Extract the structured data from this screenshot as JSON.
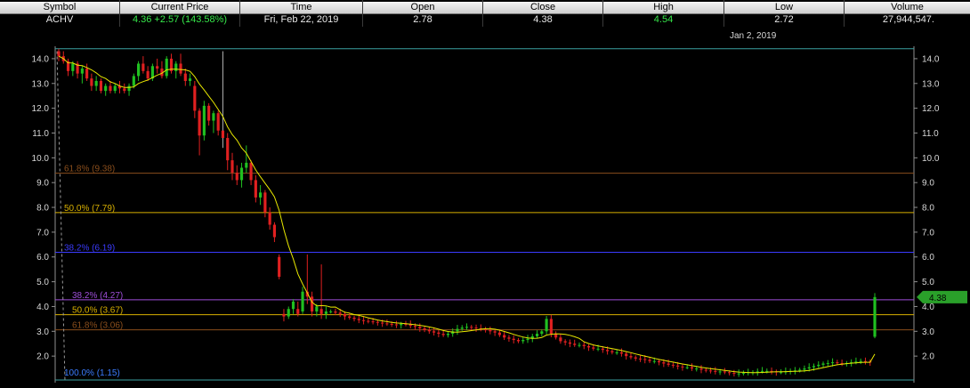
{
  "quote": {
    "headers": {
      "symbol": "Symbol",
      "current_price": "Current Price",
      "time": "Time",
      "open": "Open",
      "close": "Close",
      "high": "High",
      "low": "Low",
      "volume": "Volume"
    },
    "values": {
      "symbol": "ACHV",
      "current_price": "4.36",
      "change": "+2.57 (143.58%)",
      "time": "Fri, Feb 22, 2019",
      "open": "2.78",
      "close": "4.38",
      "high": "4.54",
      "low": "2.72",
      "volume": "27,944,547."
    }
  },
  "colors": {
    "up_candle": "#20c020",
    "down_candle": "#e02020",
    "moving_average": "#e8e800",
    "high_value": "#36e84a",
    "last_price_tag": "#2aa02a"
  },
  "chart_data": {
    "type": "candlestick",
    "cursor_date_label": "Jan 2, 2019",
    "ylim": [
      1.0,
      14.5
    ],
    "yticks": [
      "14.0",
      "13.0",
      "12.0",
      "11.0",
      "10.0",
      "9.0",
      "8.0",
      "7.0",
      "6.0",
      "5.0",
      "4.0",
      "3.0",
      "2.0"
    ],
    "last_price_label": "4.38",
    "fib_levels_major": [
      {
        "label": "61.8% (9.38)",
        "value": 9.38,
        "color": "#8a4e1c"
      },
      {
        "label": "50.0% (7.79)",
        "value": 7.79,
        "color": "#d8b000"
      },
      {
        "label": "38.2% (6.19)",
        "value": 6.19,
        "color": "#3b3bff"
      },
      {
        "label": "100.0% (1.15)",
        "value": 1.15,
        "color": "#3b7cff"
      }
    ],
    "fib_levels_minor": [
      {
        "label": "38.2% (4.27)",
        "value": 4.27,
        "color": "#9e4ed8"
      },
      {
        "label": "50.0% (3.67)",
        "value": 3.67,
        "color": "#d8b000"
      },
      {
        "label": "61.8% (3.06)",
        "value": 3.06,
        "color": "#8a4e1c"
      }
    ],
    "top_line": 14.4,
    "candles": [
      [
        14.3,
        14.4,
        13.9,
        14.1
      ],
      [
        14.1,
        14.3,
        13.8,
        13.9
      ],
      [
        13.9,
        14.0,
        13.3,
        13.5
      ],
      [
        13.5,
        13.9,
        13.3,
        13.8
      ],
      [
        13.8,
        13.9,
        13.2,
        13.4
      ],
      [
        13.4,
        13.7,
        13.0,
        13.6
      ],
      [
        13.6,
        13.8,
        13.1,
        13.2
      ],
      [
        13.2,
        13.4,
        12.7,
        12.9
      ],
      [
        12.9,
        13.3,
        12.7,
        13.1
      ],
      [
        13.1,
        13.2,
        12.6,
        12.7
      ],
      [
        12.7,
        13.0,
        12.5,
        12.9
      ],
      [
        12.9,
        13.1,
        12.6,
        12.7
      ],
      [
        12.7,
        13.0,
        12.6,
        12.9
      ],
      [
        12.9,
        13.1,
        12.6,
        12.8
      ],
      [
        12.8,
        13.0,
        12.6,
        12.7
      ],
      [
        12.7,
        13.0,
        12.5,
        12.9
      ],
      [
        12.9,
        13.4,
        12.8,
        13.3
      ],
      [
        13.3,
        13.9,
        13.1,
        13.8
      ],
      [
        13.8,
        14.1,
        13.4,
        13.5
      ],
      [
        13.5,
        13.7,
        13.1,
        13.2
      ],
      [
        13.2,
        13.8,
        13.1,
        13.7
      ],
      [
        13.7,
        14.0,
        13.4,
        13.6
      ],
      [
        13.6,
        13.9,
        13.2,
        13.3
      ],
      [
        13.3,
        14.1,
        13.2,
        14.0
      ],
      [
        14.0,
        14.2,
        13.4,
        13.5
      ],
      [
        13.5,
        13.9,
        13.2,
        13.8
      ],
      [
        13.8,
        14.2,
        13.3,
        13.4
      ],
      [
        13.4,
        13.6,
        12.9,
        13.1
      ],
      [
        13.1,
        13.4,
        12.9,
        13.2
      ],
      [
        12.9,
        13.1,
        11.6,
        11.9
      ],
      [
        11.9,
        12.0,
        10.1,
        10.9
      ],
      [
        10.9,
        12.3,
        10.7,
        12.1
      ],
      [
        12.1,
        12.2,
        11.3,
        11.5
      ],
      [
        11.5,
        11.9,
        11.0,
        11.8
      ],
      [
        11.8,
        11.9,
        10.9,
        11.1
      ],
      [
        11.1,
        14.3,
        10.4,
        10.8
      ],
      [
        10.8,
        11.0,
        9.5,
        9.9
      ],
      [
        9.9,
        10.2,
        9.1,
        9.4
      ],
      [
        9.4,
        9.7,
        8.9,
        9.1
      ],
      [
        9.1,
        9.8,
        8.8,
        9.6
      ],
      [
        9.6,
        10.5,
        9.4,
        9.8
      ],
      [
        9.8,
        9.9,
        8.9,
        9.1
      ],
      [
        9.1,
        9.3,
        8.2,
        8.4
      ],
      [
        8.4,
        8.9,
        8.1,
        8.6
      ],
      [
        8.6,
        8.7,
        7.6,
        7.8
      ],
      [
        7.8,
        8.0,
        7.1,
        7.3
      ],
      [
        7.3,
        7.4,
        6.6,
        6.8
      ],
      [
        6.0,
        6.1,
        5.1,
        5.2
      ],
      [
        3.7,
        3.9,
        3.4,
        3.6
      ],
      [
        3.6,
        4.0,
        3.5,
        3.9
      ],
      [
        3.9,
        4.3,
        3.7,
        4.2
      ],
      [
        3.9,
        4.2,
        3.6,
        3.7
      ],
      [
        3.8,
        4.8,
        3.7,
        4.6
      ],
      [
        4.6,
        6.1,
        4.1,
        4.4
      ],
      [
        4.4,
        4.6,
        3.6,
        3.8
      ],
      [
        3.8,
        4.1,
        3.6,
        4.0
      ],
      [
        3.9,
        5.7,
        3.5,
        3.7
      ],
      [
        3.7,
        4.0,
        3.5,
        3.8
      ]
    ],
    "late_closes": [
      3.8,
      3.75,
      3.7,
      3.6,
      3.55,
      3.5,
      3.45,
      3.42,
      3.4,
      3.38,
      3.35,
      3.32,
      3.3,
      3.28,
      3.25,
      3.3,
      3.28,
      3.22,
      3.18,
      3.12,
      3.05,
      3.0,
      2.95,
      2.9,
      2.85,
      2.9,
      3.0,
      3.1,
      3.15,
      3.18,
      3.15,
      3.12,
      3.08,
      3.05,
      3.0,
      2.95,
      2.85,
      2.75,
      2.7,
      2.65,
      2.6,
      2.65,
      2.7,
      2.8,
      2.9,
      3.0,
      3.5,
      2.9,
      2.75,
      2.6,
      2.55,
      2.5,
      2.45,
      2.45,
      2.4,
      2.35,
      2.3,
      2.3,
      2.25,
      2.2,
      2.15,
      2.15,
      2.1,
      2.0,
      1.95,
      1.9,
      1.88,
      1.85,
      1.8,
      1.8,
      1.75,
      1.7,
      1.65,
      1.62,
      1.58,
      1.55,
      1.55,
      1.5,
      1.5,
      1.45,
      1.42,
      1.4,
      1.38,
      1.38,
      1.35,
      1.32,
      1.3,
      1.3,
      1.32,
      1.35,
      1.35,
      1.38,
      1.4,
      1.4,
      1.38,
      1.35,
      1.35,
      1.38,
      1.4,
      1.42,
      1.45,
      1.5,
      1.55,
      1.6,
      1.65,
      1.7,
      1.72,
      1.75,
      1.72,
      1.7,
      1.72,
      1.75,
      1.78,
      1.8,
      1.78,
      1.75
    ],
    "last_candle": [
      2.78,
      4.54,
      2.72,
      4.38
    ]
  }
}
